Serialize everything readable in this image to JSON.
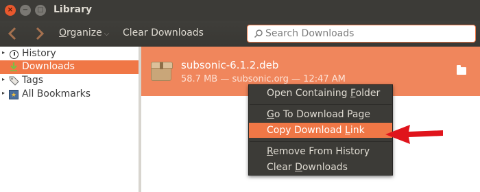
{
  "window": {
    "title": "Library",
    "close_glyph": "×",
    "min_glyph": "−",
    "max_glyph": "□"
  },
  "toolbar": {
    "back_icon": "chevron-left",
    "forward_icon": "chevron-right",
    "organize_first": "O",
    "organize_rest": "rganize",
    "organize_caret": "⌵",
    "clear_downloads": "Clear Downloads",
    "search_placeholder": "Search Downloads"
  },
  "sidebar": {
    "items": [
      {
        "label": "History",
        "expander": "▸",
        "icon": "clock-icon"
      },
      {
        "label": "Downloads",
        "icon": "down-arrow-icon",
        "selected": true
      },
      {
        "label": "Tags",
        "expander": "▸",
        "icon": "tag-icon"
      },
      {
        "label": "All Bookmarks",
        "expander": "▸",
        "icon": "bookmarks-icon"
      }
    ]
  },
  "download": {
    "filename": "subsonic-6.1.2.deb",
    "meta": "58.7 MB — subsonic.org — 12:47 AM"
  },
  "context_menu": {
    "items": [
      {
        "pre": "Open Containing ",
        "u": "F",
        "post": "older"
      },
      {
        "pre": "",
        "u": "G",
        "post": "o To Download Page"
      },
      {
        "pre": "Copy Download ",
        "u": "L",
        "post": "ink",
        "highlighted": true
      },
      {
        "pre": "",
        "u": "R",
        "post": "emove From History"
      },
      {
        "pre": "Clear ",
        "u": "D",
        "post": "ownloads"
      }
    ]
  },
  "colors": {
    "accent": "#f07746",
    "selected_row": "#f0865c",
    "annotation_arrow": "#e0141c"
  }
}
